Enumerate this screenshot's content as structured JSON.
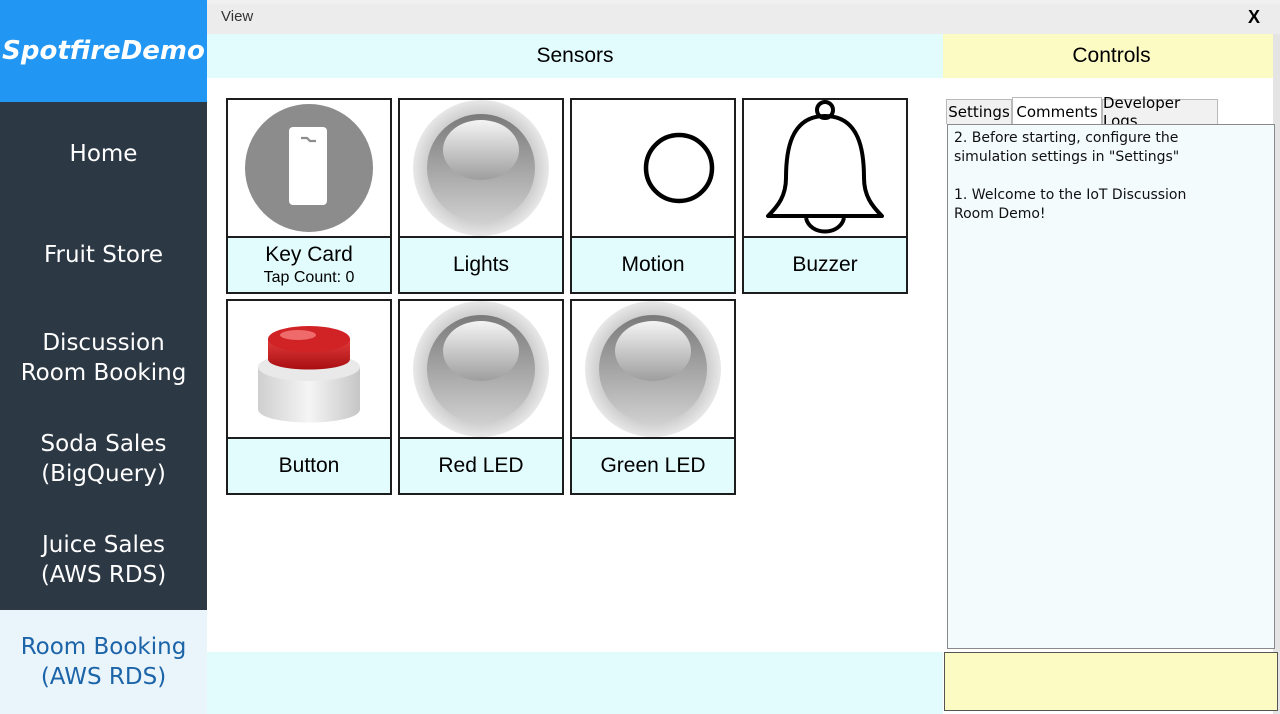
{
  "app": {
    "brand": "SpotfireDemo"
  },
  "sidebar": {
    "items": [
      {
        "label": "Home"
      },
      {
        "label": "Fruit Store"
      },
      {
        "label": "Discussion\nRoom Booking"
      },
      {
        "label": "Soda Sales\n(BigQuery)"
      },
      {
        "label": "Juice Sales\n(AWS RDS)"
      },
      {
        "label": "Room Booking\n(AWS RDS)"
      }
    ],
    "active_index": 5
  },
  "viewbar": {
    "label": "View",
    "close": "X"
  },
  "sensors": {
    "title": "Sensors",
    "tiles": [
      {
        "label": "Key Card",
        "sublabel": "Tap Count: 0",
        "icon": "key-card-icon"
      },
      {
        "label": "Lights",
        "icon": "light-bulb-icon"
      },
      {
        "label": "Motion",
        "icon": "motion-circle-icon"
      },
      {
        "label": "Buzzer",
        "icon": "bell-icon"
      },
      {
        "label": "Button",
        "icon": "red-push-button-icon"
      },
      {
        "label": "Red LED",
        "icon": "led-icon"
      },
      {
        "label": "Green LED",
        "icon": "led-icon"
      }
    ]
  },
  "controls": {
    "title": "Controls",
    "tabs": [
      {
        "label": "Settings"
      },
      {
        "label": "Comments"
      },
      {
        "label": "Developer Logs"
      }
    ],
    "active_tab": "Comments",
    "comments": "2. Before starting, configure the\nsimulation settings in \"Settings\"\n\n1. Welcome to the IoT Discussion\nRoom Demo!"
  },
  "colors": {
    "brand_blue": "#2196f3",
    "sidebar_dark": "#2c3844",
    "sensors_bg": "#e2fbfd",
    "controls_bg": "#fcfbc4",
    "active_nav_text": "#1c64a8"
  }
}
